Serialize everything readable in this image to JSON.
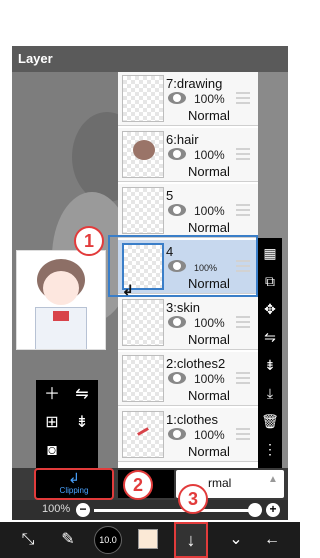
{
  "panel": {
    "title": "Layer"
  },
  "layers": [
    {
      "number": "7",
      "name": "drawing",
      "label": "7:drawing",
      "opacity": "100%",
      "blend": "Normal",
      "selected": false
    },
    {
      "number": "6",
      "name": "hair",
      "label": "6:hair",
      "opacity": "100%",
      "blend": "Normal",
      "selected": false
    },
    {
      "number": "5",
      "name": "",
      "label": "5",
      "opacity": "100%",
      "blend": "Normal",
      "selected": false
    },
    {
      "number": "4",
      "name": "",
      "label": "4",
      "opacity": "100%",
      "blend": "Normal",
      "selected": true
    },
    {
      "number": "3",
      "name": "skin",
      "label": "3:skin",
      "opacity": "100%",
      "blend": "Normal",
      "selected": false
    },
    {
      "number": "2",
      "name": "clothes2",
      "label": "2:clothes2",
      "opacity": "100%",
      "blend": "Normal",
      "selected": false
    },
    {
      "number": "1",
      "name": "clothes",
      "label": "1:clothes",
      "opacity": "100%",
      "blend": "Normal",
      "selected": false
    }
  ],
  "blend_bar": {
    "clipping_label": "Clipping",
    "blend_mode": "rmal"
  },
  "opacity_bar": {
    "value": "100%",
    "minus": "−",
    "plus": "+"
  },
  "bottom_bar": {
    "brush_size": "10.0"
  },
  "annotations": {
    "badge_1": "1",
    "badge_2": "2",
    "badge_3": "3"
  },
  "right_toolbar_icons": [
    "checker-icon",
    "transform-icon",
    "move-icon",
    "flip-icon",
    "merge-down-icon",
    "import-icon",
    "trash-icon",
    "more-icon"
  ],
  "left_toolbar_icons": [
    "add-layer-icon",
    "flip-layer-icon",
    "copy-layer-icon",
    "merge-icon",
    "camera-icon"
  ],
  "colors": {
    "accent_blue": "#4aa3ff",
    "selected_row": "#c7d8ee",
    "annotation_red": "#e23b3b",
    "swatch": "#fbe9d6"
  }
}
